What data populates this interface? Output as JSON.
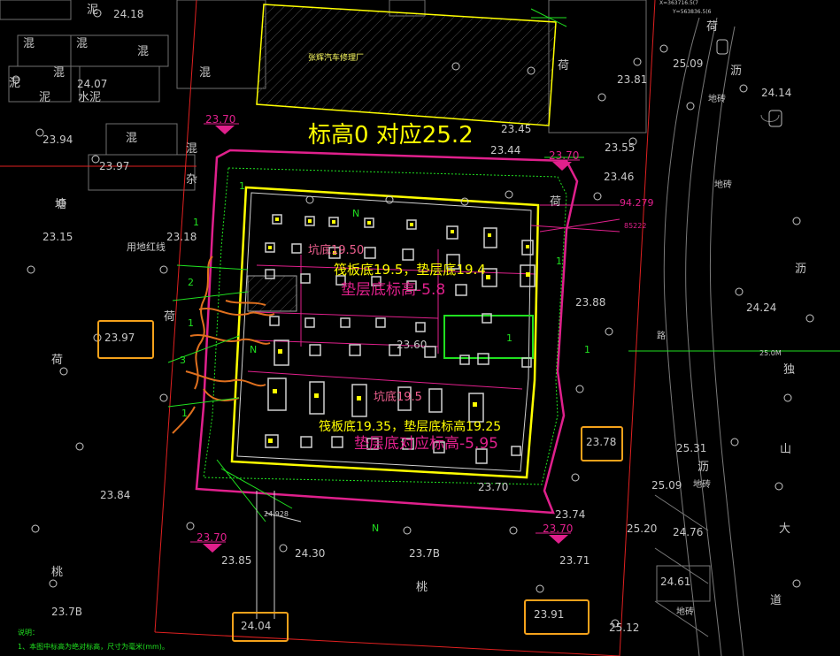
{
  "main_title": "标高0 对应25.2",
  "building_label": "张辉汽车修理厂",
  "redline_label": "用地红线",
  "coord_top_1": "X=363716.5(7",
  "coord_top_2": "Y=563836.5(6",
  "pit_labels": {
    "upper_yellow": "筏板底19.5，垫层底19.4",
    "upper_magenta": "垫层底标高-5.8",
    "upper_orange": "坑底19.50",
    "lower_yellow": "筏板底19.35，垫层底标高19.25",
    "lower_magenta": "垫层底对应标高-5.95",
    "lower_orange": "坑底19.5"
  },
  "magenta_levels": [
    "23.70",
    "23.70",
    "23.70",
    "23.70"
  ],
  "highlighted_elevations": [
    "23.97",
    "23.78",
    "24.04",
    "23.91"
  ],
  "elevations": [
    "24.18",
    "24.07",
    "23.94",
    "23.97",
    "23.15",
    "23.18",
    "23.84",
    "23.85",
    "23.7B",
    "24.30",
    "23.7B",
    "23.71",
    "23.74",
    "23.70",
    "23.60",
    "23.45",
    "23.44",
    "23.55",
    "23.46",
    "23.81",
    "25.09",
    "24.14",
    "23.88",
    "24.24",
    "25.31",
    "25.09",
    "25.20",
    "24.76",
    "24.61",
    "25.12",
    "25.0M",
    "24.928",
    "94.279",
    "85222"
  ],
  "ground_chars": [
    "泥",
    "混",
    "混",
    "混",
    "泥",
    "混",
    "泥",
    "混",
    "水泥",
    "混",
    "混",
    "塘",
    "荷",
    "荷",
    "杂",
    "荷",
    "桃",
    "桃",
    "地砖",
    "山",
    "大",
    "道",
    "地砖",
    "地砖",
    "沥",
    "独",
    "荷",
    "沥",
    "沥",
    "荷",
    "路",
    "地砖"
  ],
  "slope_marks": [
    "1",
    "2",
    "3",
    "1",
    "1",
    "1",
    "1",
    "1",
    "1",
    "N",
    "N",
    "N"
  ],
  "notes_title": "说明：",
  "notes_line": "1、本图中标高为绝对标高，尺寸为毫米(mm)。",
  "colors": {
    "magenta": "#e0208c",
    "yellow": "#ffff00",
    "green": "#20e020",
    "red": "#e02020",
    "orange": "#f5a21b",
    "white": "#c8c8c8",
    "grey": "#808080",
    "orangeDark": "#e0701e"
  }
}
